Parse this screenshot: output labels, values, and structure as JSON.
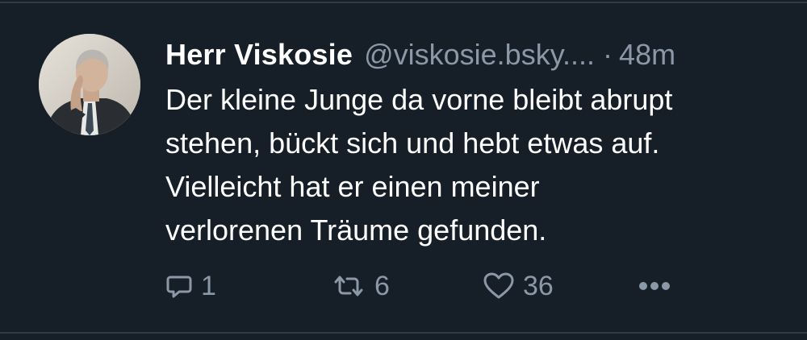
{
  "post": {
    "author": {
      "display_name": "Herr Viskosie",
      "handle": "@viskosie.bsky....",
      "avatar_icon": "user-avatar-photo"
    },
    "separator": "·",
    "time": "48m",
    "text_lines": [
      "Der kleine Junge da vorne bleibt abrupt",
      "stehen, bückt sich und hebt etwas auf.",
      "Vielleicht hat er einen meiner",
      "verlorenen Träume gefunden."
    ],
    "actions": {
      "reply": {
        "icon": "reply-icon",
        "count": "1"
      },
      "repost": {
        "icon": "repost-icon",
        "count": "6"
      },
      "like": {
        "icon": "heart-icon",
        "count": "36"
      },
      "more": {
        "icon": "more-icon"
      }
    }
  },
  "colors": {
    "background": "#161e27",
    "text": "#ffffff",
    "muted": "#8b98a7",
    "divider": "#2e3a48"
  }
}
